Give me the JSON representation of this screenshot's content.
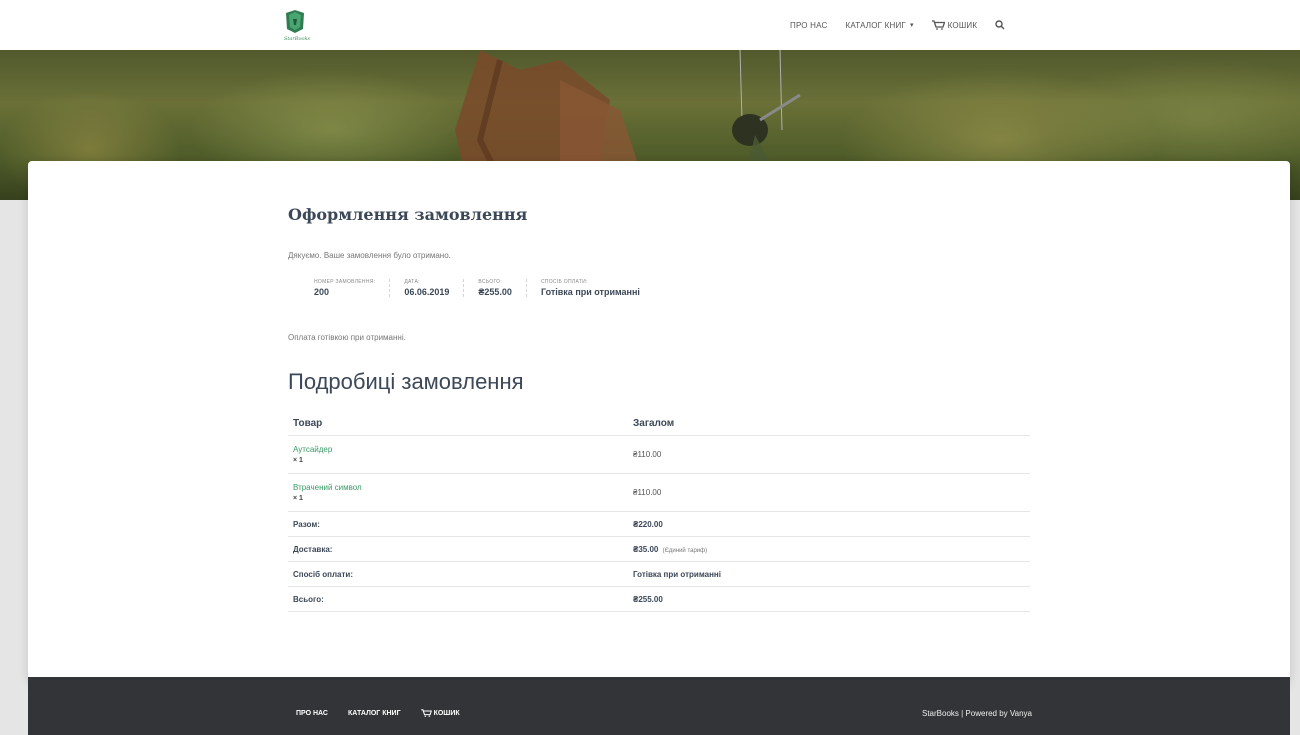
{
  "header": {
    "logo_text": "StarBooks",
    "nav": {
      "about": "ПРО НАС",
      "catalog": "КАТАЛОГ КНИГ",
      "cart": "КОШИК"
    },
    "icons": [
      "cart-icon",
      "chevron-down-icon",
      "search-icon"
    ]
  },
  "order": {
    "title": "Оформлення замовлення",
    "thanks": "Дякуємо. Ваше замовлення було отримано.",
    "overview": [
      {
        "label": "НОМЕР ЗАМОВЛЕННЯ:",
        "value": "200"
      },
      {
        "label": "ДАТА:",
        "value": "06.06.2019"
      },
      {
        "label": "ВСЬОГО:",
        "value": "₴255.00"
      },
      {
        "label": "СПОСІБ ОПЛАТИ:",
        "value": "Готівка при отриманні"
      }
    ],
    "payment_note": "Оплата готівкою при отриманні."
  },
  "details": {
    "title": "Подробиці замовлення",
    "headers": {
      "product": "Товар",
      "total": "Загалом"
    },
    "items": [
      {
        "name": "Аутсайдер",
        "qty": "× 1",
        "price": "₴110.00"
      },
      {
        "name": "Втрачений символ",
        "qty": "× 1",
        "price": "₴110.00"
      }
    ],
    "totals": [
      {
        "label": "Разом:",
        "value": "₴220.00",
        "note": ""
      },
      {
        "label": "Доставка:",
        "value": "₴35.00",
        "note": "(Єдиний тариф)"
      },
      {
        "label": "Спосіб оплати:",
        "value": "Готівка при отриманні",
        "note": ""
      },
      {
        "label": "Всього:",
        "value": "₴255.00",
        "note": ""
      }
    ]
  },
  "footer": {
    "nav": {
      "about": "ПРО НАС",
      "catalog": "КАТАЛОГ КНИГ",
      "cart": "КОШИК"
    },
    "copyright": "StarBooks | Powered by Vanya"
  },
  "colors": {
    "accent": "#3a9a66",
    "footer": "#323437",
    "text": "#3c4858"
  }
}
